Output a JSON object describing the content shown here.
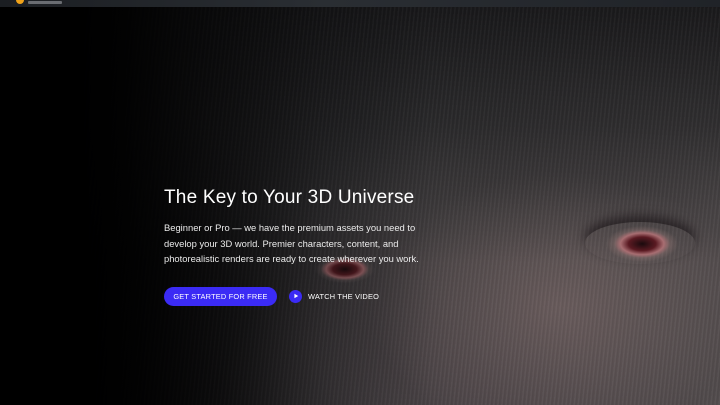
{
  "hero": {
    "title": "The Key to Your 3D Universe",
    "description": "Beginner or Pro — we have the premium assets you need to develop your 3D world. Premier characters, content, and photorealistic renders are ready to create wherever you work.",
    "primary_cta": "GET STARTED FOR FREE",
    "secondary_cta": "WATCH THE VIDEO"
  },
  "icons": {
    "logo": "logo-icon",
    "play": "play-icon"
  },
  "colors": {
    "accent": "#3b2bf5",
    "logo": "#f0a219",
    "text": "#ffffff"
  }
}
